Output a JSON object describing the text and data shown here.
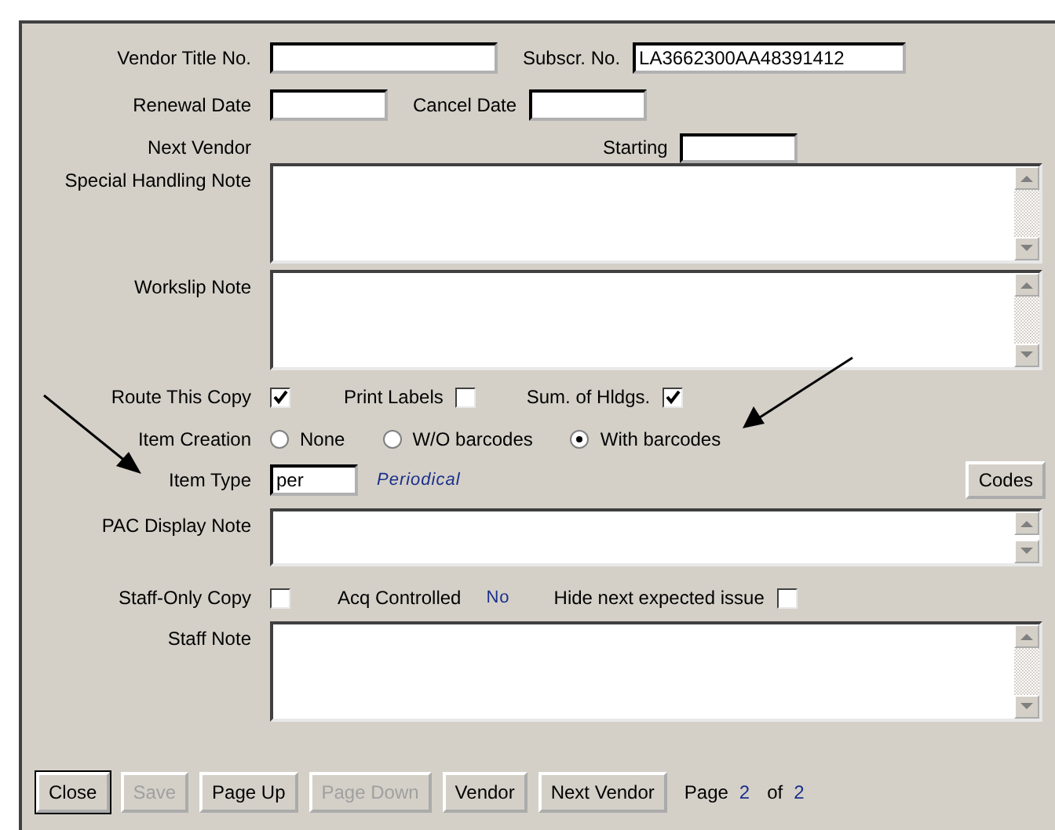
{
  "vendor_title_no": {
    "label": "Vendor Title No."
  },
  "subscr_no": {
    "label": "Subscr. No.",
    "value": "LA3662300AA48391412"
  },
  "renewal_date": {
    "label": "Renewal Date"
  },
  "cancel_date": {
    "label": "Cancel Date"
  },
  "next_vendor": {
    "label": "Next Vendor"
  },
  "starting": {
    "label": "Starting"
  },
  "special_handling_note": {
    "label": "Special Handling Note"
  },
  "workslip_note": {
    "label": "Workslip Note"
  },
  "route_this_copy": {
    "label": "Route This Copy",
    "checked": true
  },
  "print_labels": {
    "label": "Print Labels",
    "checked": false
  },
  "sum_of_hldgs": {
    "label": "Sum. of Hldgs.",
    "checked": true
  },
  "item_creation": {
    "label": "Item Creation",
    "options": [
      {
        "label": "None",
        "selected": false
      },
      {
        "label": "W/O barcodes",
        "selected": false
      },
      {
        "label": "With barcodes",
        "selected": true
      }
    ]
  },
  "item_type": {
    "label": "Item Type",
    "value": "per",
    "description": "Periodical"
  },
  "codes_button": "Codes",
  "pac_display_note": {
    "label": "PAC Display Note"
  },
  "staff_only_copy": {
    "label": "Staff-Only Copy",
    "checked": false
  },
  "acq_controlled": {
    "label": "Acq Controlled",
    "value": "No"
  },
  "hide_next_expected_issue": {
    "label": "Hide next expected issue",
    "checked": false
  },
  "staff_note": {
    "label": "Staff Note"
  },
  "buttons": [
    {
      "label": "Close",
      "disabled": false,
      "default": true
    },
    {
      "label": "Save",
      "disabled": true,
      "default": false
    },
    {
      "label": "Page Up",
      "disabled": false,
      "default": false
    },
    {
      "label": "Page Down",
      "disabled": true,
      "default": false
    },
    {
      "label": "Vendor",
      "disabled": false,
      "default": false
    },
    {
      "label": "Next Vendor",
      "disabled": false,
      "default": false
    }
  ],
  "pager": {
    "label": "Page",
    "current": "2",
    "of_label": "of",
    "total": "2"
  }
}
